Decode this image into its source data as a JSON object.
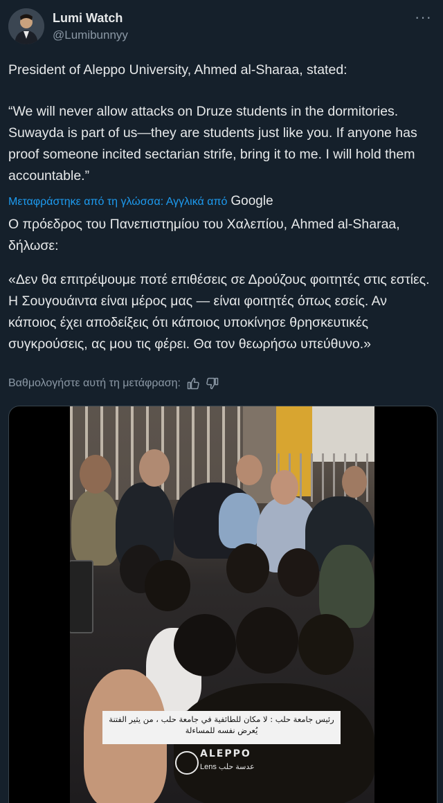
{
  "author": {
    "display_name": "Lumi Watch",
    "handle": "@Lumibunnyy",
    "more_icon": "more-horizontal-icon"
  },
  "tweet": {
    "original_intro": "President of Aleppo University, Ahmed al-Sharaa, stated:",
    "original_quote": "“We will never allow attacks on Druze students in the dormitories. Suwayda is part of us—they are students just like you. If anyone has proof someone incited sectarian strife, bring it to me. I will hold them accountable.”",
    "translated_by": "Μεταφράστηκε από τη γλώσσα: Αγγλικά από",
    "translator": "Google",
    "translated_intro": "Ο πρόεδρος του Πανεπιστημίου του Χαλεπίου, Ahmed al-Sharaa, δήλωσε:",
    "translated_quote": "«Δεν θα επιτρέψουμε ποτέ επιθέσεις σε Δρούζους φοιτητές στις εστίες. Η Σουγουάιντα είναι μέρος μας — είναι φοιτητές όπως εσείς. Αν κάποιος έχει αποδείξεις ότι κάποιος υποκίνησε θρησκευτικές συγκρούσεις, ας μου τις φέρει. Θα τον θεωρήσω υπεύθυνο.»",
    "rate_label": "Βαθμολογήστε αυτή τη μετάφραση:",
    "thumbs_up_icon": "thumbs-up-icon",
    "thumbs_down_icon": "thumbs-down-icon"
  },
  "media": {
    "caption": "رئيس جامعة حلب : لا مكان للطائفية في جامعة حلب ، من يثير الفتنة يُعرض نفسه للمساءلة",
    "logo_top": "ALEPPO",
    "logo_bottom": "عدسة حلب Lens"
  },
  "colors": {
    "background": "#15202b",
    "text": "#e7e9ea",
    "secondary_text": "#8b98a5",
    "link": "#1d9bf0"
  }
}
